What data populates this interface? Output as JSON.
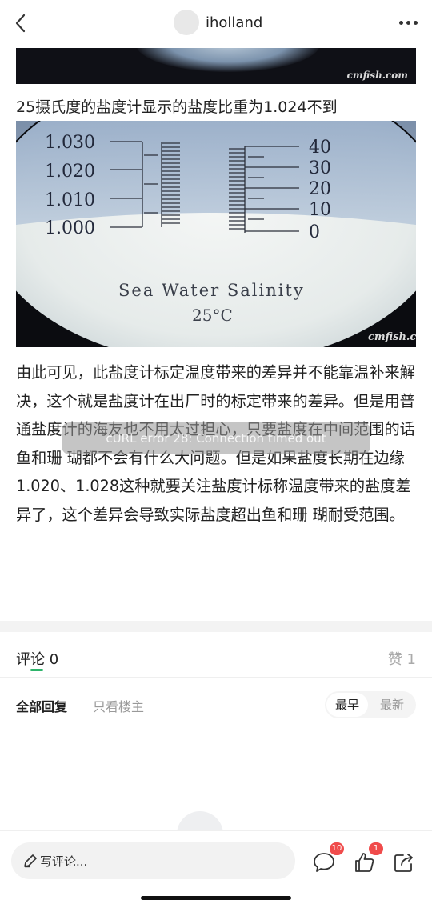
{
  "header": {
    "author": "iholland"
  },
  "post": {
    "image1_watermark": "cmfish.com",
    "caption": "25摄氏度的盐度计显示的盐度比重为1.024不到",
    "image2": {
      "sg_ticks": [
        "1.030",
        "1.020",
        "1.010",
        "1.000"
      ],
      "salinity_ticks": [
        "40",
        "30",
        "20",
        "10",
        "0"
      ],
      "title": "Sea Water Salinity",
      "temp": "25°C",
      "watermark": "cmfish.com"
    },
    "paragraph": "由此可见，此盐度计标定温度带来的差异并不能靠温补来解决，这个就是盐度计在出厂时的标定带来的差异。但是用普通盐度计的海友也不用太过担心，只要盐度在中间范围的话鱼和珊 瑚都不会有什么大问题。但是如果盐度长期在边缘1.020、1.028这种就要关注盐度计标称温度带来的盐度差异了，这个差异会导致实际盐度超出鱼和珊 瑚耐受范围。"
  },
  "toast": "cURL error 28: Connection timed out",
  "comments": {
    "header": "评论 0",
    "likes": "赞 1",
    "filter_all": "全部回复",
    "filter_op": "只看楼主",
    "sort_earliest": "最早",
    "sort_latest": "最新"
  },
  "bottombar": {
    "placeholder": "写评论...",
    "comment_badge": "10",
    "like_badge": "1"
  },
  "colors": {
    "accent": "#2db46a",
    "badge": "#f04b4b"
  }
}
